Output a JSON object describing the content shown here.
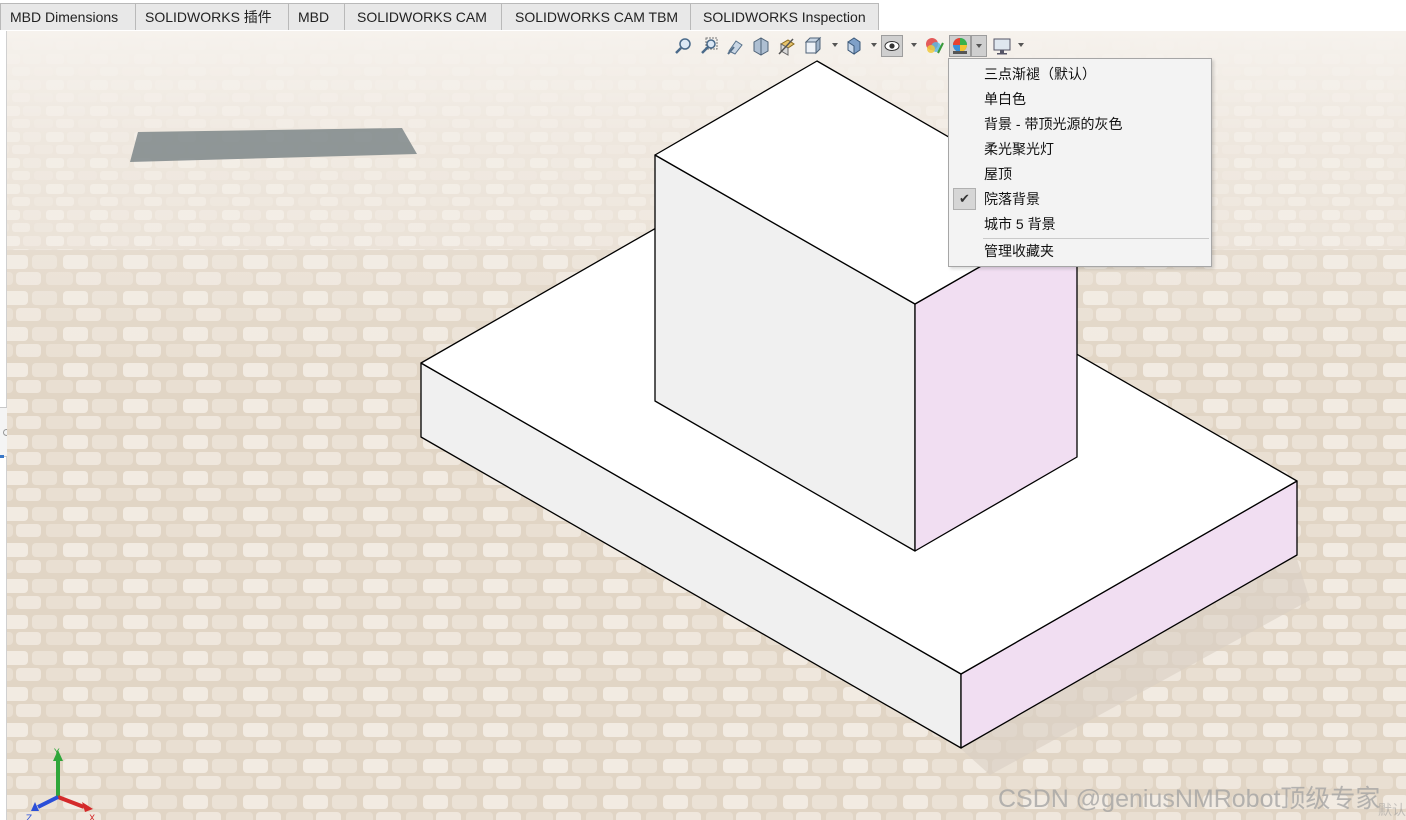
{
  "tabs": [
    {
      "label": "MBD Dimensions"
    },
    {
      "label": "SOLIDWORKS 插件"
    },
    {
      "label": "MBD"
    },
    {
      "label": "SOLIDWORKS CAM"
    },
    {
      "label": "SOLIDWORKS CAM TBM"
    },
    {
      "label": "SOLIDWORKS Inspection"
    }
  ],
  "toolbar": {
    "buttons": [
      {
        "icon": "zoom-to-fit-icon"
      },
      {
        "icon": "zoom-to-area-icon"
      },
      {
        "icon": "previous-view-icon"
      },
      {
        "icon": "section-view-icon"
      },
      {
        "icon": "dynamic-annotation-views-icon"
      },
      {
        "icon": "view-orientation-icon"
      },
      {
        "icon": "display-style-icon"
      },
      {
        "icon": "hide-show-items-icon"
      },
      {
        "icon": "edit-appearance-icon"
      },
      {
        "icon": "apply-scene-icon"
      },
      {
        "icon": "view-settings-icon"
      }
    ]
  },
  "scene_menu": {
    "items": [
      {
        "label": "三点渐褪（默认）",
        "checked": false
      },
      {
        "label": "单白色",
        "checked": false
      },
      {
        "label": "背景 - 带顶光源的灰色",
        "checked": false
      },
      {
        "label": "柔光聚光灯",
        "checked": false
      },
      {
        "label": "屋顶",
        "checked": false
      },
      {
        "label": "院落背景",
        "checked": true
      },
      {
        "label": "城市 5 背景",
        "checked": false
      }
    ],
    "manage_label": "管理收藏夹",
    "check_glyph": "✔"
  },
  "triad": {
    "x": "X",
    "y": "Y",
    "z": "Z"
  },
  "watermark": "CSDN @geniusNMRobot顶级专家",
  "corner_text": "默认",
  "colors": {
    "face_top": "#ffffff",
    "face_left": "#f0f0f0",
    "face_right": "#f1def2",
    "edge": "#000000",
    "axis_x": "#d42a2a",
    "axis_y": "#2fa63a",
    "axis_z": "#2b4fd8"
  }
}
